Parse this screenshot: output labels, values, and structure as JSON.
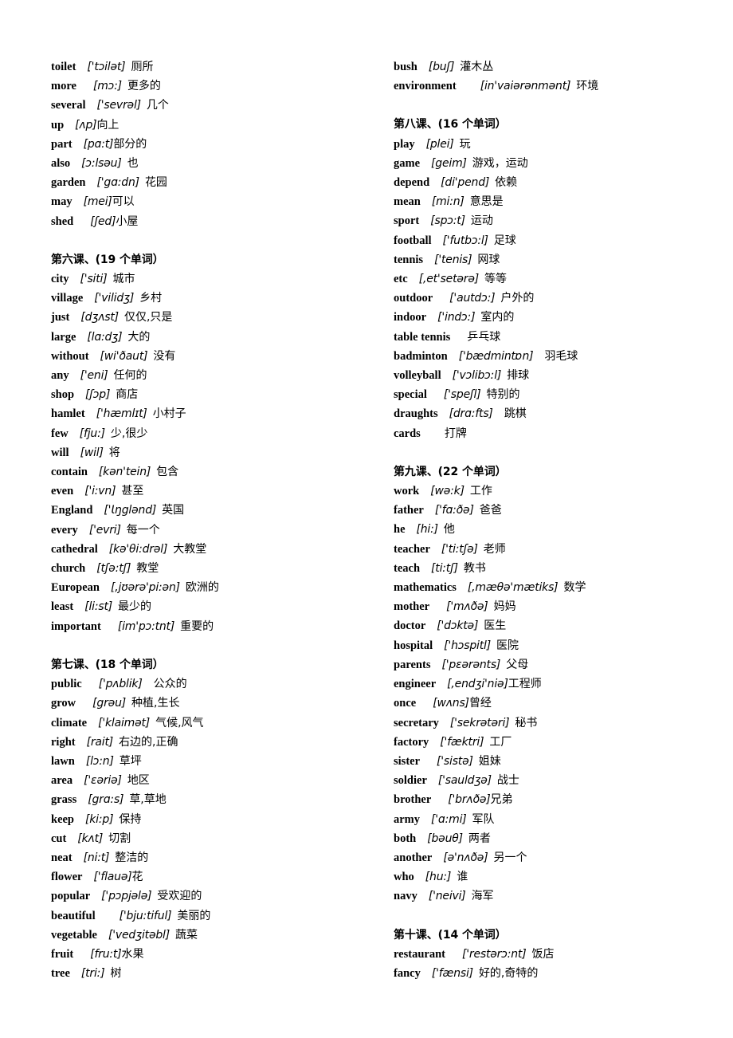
{
  "document": {
    "type": "vocabulary-list",
    "language_pair": "English-Chinese",
    "text_color": "#000000",
    "background_color": "#ffffff"
  },
  "columns": [
    {
      "name": "left-column",
      "sections": [
        {
          "heading": null,
          "entries": [
            {
              "word": "toilet",
              "phonetic": "['tɔilət]",
              "gloss": "厕所",
              "gap1": "sp2",
              "gap2": "sp1"
            },
            {
              "word": "more",
              "phonetic": "[mɔ:]",
              "gloss": "更多的",
              "gap1": "sp3",
              "gap2": "sp1"
            },
            {
              "word": "several",
              "phonetic": "['sevrəl]",
              "gloss": "几个",
              "gap1": "sp2",
              "gap2": "sp1"
            },
            {
              "word": "up",
              "phonetic": "[ʌp]",
              "gloss": "向上",
              "gap1": "sp2",
              "gap2": "sp0"
            },
            {
              "word": "part",
              "phonetic": "[pɑ:t]",
              "gloss": "部分的",
              "gap1": "sp2",
              "gap2": "sp0"
            },
            {
              "word": "also",
              "phonetic": "[ɔ:lsəu]",
              "gloss": "也",
              "gap1": "sp2",
              "gap2": "sp1"
            },
            {
              "word": "garden",
              "phonetic": "['gɑ:dn]",
              "gloss": "花园",
              "gap1": "sp2",
              "gap2": "sp1"
            },
            {
              "word": "may",
              "phonetic": "[mei]",
              "gloss": "可以",
              "gap1": "sp2",
              "gap2": "sp0"
            },
            {
              "word": "shed",
              "phonetic": "[ʃed]",
              "gloss": "小屋",
              "gap1": "sp3",
              "gap2": "sp0"
            }
          ]
        },
        {
          "heading": "第六课、(19 个单词）",
          "entries": [
            {
              "word": "city",
              "phonetic": "['siti]",
              "gloss": "城市",
              "gap1": "sp2",
              "gap2": "sp1"
            },
            {
              "word": "village",
              "phonetic": "['vilidʒ]",
              "gloss": "乡村",
              "gap1": "sp2",
              "gap2": "sp1"
            },
            {
              "word": "just",
              "phonetic": "[dʒʌst]",
              "gloss": "仅仅,只是",
              "gap1": "sp2",
              "gap2": "sp1"
            },
            {
              "word": "large",
              "phonetic": "[lɑ:dʒ]",
              "gloss": "大的",
              "gap1": "sp2",
              "gap2": "sp1"
            },
            {
              "word": "without",
              "phonetic": "[wi'ðaut]",
              "gloss": "没有",
              "gap1": "sp2",
              "gap2": "sp1"
            },
            {
              "word": "any",
              "phonetic": "['eni]",
              "gloss": "任何的",
              "gap1": "sp2",
              "gap2": "sp1"
            },
            {
              "word": "shop",
              "phonetic": "[ʃɔp]",
              "gloss": "商店",
              "gap1": "sp2",
              "gap2": "sp1"
            },
            {
              "word": "hamlet",
              "phonetic": "['hæmlɪt]",
              "gloss": "小村子",
              "gap1": "sp2",
              "gap2": "sp1"
            },
            {
              "word": "few",
              "phonetic": "[fju:]",
              "gloss": "少,很少",
              "gap1": "sp2",
              "gap2": "sp1"
            },
            {
              "word": "will",
              "phonetic": "[wil]",
              "gloss": "将",
              "gap1": "sp2",
              "gap2": "sp1"
            },
            {
              "word": "contain",
              "phonetic": "[kən'tein]",
              "gloss": "包含",
              "gap1": "sp2",
              "gap2": "sp1"
            },
            {
              "word": "even",
              "phonetic": "['i:vn]",
              "gloss": "甚至",
              "gap1": "sp2",
              "gap2": "sp1"
            },
            {
              "word": "England",
              "phonetic": "['Ɩŋglənd]",
              "gloss": "英国",
              "gap1": "sp2",
              "gap2": "sp1"
            },
            {
              "word": "every",
              "phonetic": "['evri]",
              "gloss": "每一个",
              "gap1": "sp2",
              "gap2": "sp1"
            },
            {
              "word": "cathedral",
              "phonetic": "[kə'θi:drəl]",
              "gloss": "大教堂",
              "gap1": "sp2",
              "gap2": "sp1"
            },
            {
              "word": "church",
              "phonetic": "[tʃə:tʃ]",
              "gloss": "教堂",
              "gap1": "sp2",
              "gap2": "sp1"
            },
            {
              "word": "European",
              "phonetic": "[,jʊərə'pi:ən]",
              "gloss": "欧洲的",
              "gap1": "sp2",
              "gap2": "sp1"
            },
            {
              "word": "least",
              "phonetic": "[li:st]",
              "gloss": "最少的",
              "gap1": "sp2",
              "gap2": "sp1"
            },
            {
              "word": "important",
              "phonetic": "[im'pɔ:tnt]",
              "gloss": "重要的",
              "gap1": "sp3",
              "gap2": "sp1"
            }
          ]
        },
        {
          "heading": "第七课、(18 个单词）",
          "entries": [
            {
              "word": "public",
              "phonetic": "['pʌblik]",
              "gloss": "公众的",
              "gap1": "sp3",
              "gap2": "sp2"
            },
            {
              "word": "grow",
              "phonetic": "[grəu]",
              "gloss": "种植,生长",
              "gap1": "sp3",
              "gap2": "sp1"
            },
            {
              "word": "climate",
              "phonetic": "['klaimət]",
              "gloss": "气候,风气",
              "gap1": "sp2",
              "gap2": "sp1"
            },
            {
              "word": "right",
              "phonetic": "[rait]",
              "gloss": "右边的,正确",
              "gap1": "sp2",
              "gap2": "sp1"
            },
            {
              "word": "lawn",
              "phonetic": "[lɔ:n]",
              "gloss": "草坪",
              "gap1": "sp2",
              "gap2": "sp1"
            },
            {
              "word": "area",
              "phonetic": "['ɛəriə]",
              "gloss": "地区",
              "gap1": "sp2",
              "gap2": "sp1"
            },
            {
              "word": "grass",
              "phonetic": "[grɑ:s]",
              "gloss": "草,草地",
              "gap1": "sp2",
              "gap2": "sp1"
            },
            {
              "word": "keep",
              "phonetic": "[ki:p]",
              "gloss": "保持",
              "gap1": "sp2",
              "gap2": "sp1"
            },
            {
              "word": "cut",
              "phonetic": "[kʌt]",
              "gloss": "切割",
              "gap1": "sp2",
              "gap2": "sp1"
            },
            {
              "word": "neat",
              "phonetic": "[ni:t]",
              "gloss": "整洁的",
              "gap1": "sp2",
              "gap2": "sp1"
            },
            {
              "word": "flower",
              "phonetic": "['flauə]",
              "gloss": "花",
              "gap1": "sp2",
              "gap2": "sp0"
            },
            {
              "word": "popular",
              "phonetic": "['pɔpjələ]",
              "gloss": "受欢迎的",
              "gap1": "sp2",
              "gap2": "sp1"
            },
            {
              "word": "beautiful",
              "phonetic": "['bju:tiful]",
              "gloss": "美丽的",
              "gap1": "sp4",
              "gap2": "sp1"
            },
            {
              "word": "vegetable",
              "phonetic": "['vedʒitəbl]",
              "gloss": "蔬菜",
              "gap1": "sp2",
              "gap2": "sp1"
            },
            {
              "word": "fruit",
              "phonetic": "[fru:t]",
              "gloss": "水果",
              "gap1": "sp3",
              "gap2": "sp0"
            },
            {
              "word": "tree",
              "phonetic": "[tri:]",
              "gloss": "树",
              "gap1": "sp2",
              "gap2": "sp1"
            }
          ]
        }
      ]
    },
    {
      "name": "right-column",
      "sections": [
        {
          "heading": null,
          "entries": [
            {
              "word": "bush",
              "phonetic": "[buʃ]",
              "gloss": "灌木丛",
              "gap1": "sp2",
              "gap2": "sp1"
            },
            {
              "word": "environment",
              "phonetic": "[in'vaiərənmənt]",
              "gloss": "环境",
              "gap1": "sp4",
              "gap2": "sp1"
            }
          ]
        },
        {
          "heading": "第八课、(16 个单词）",
          "entries": [
            {
              "word": "play",
              "phonetic": "[plei]",
              "gloss": "玩",
              "gap1": "sp2",
              "gap2": "sp1"
            },
            {
              "word": "game",
              "phonetic": "[geim]",
              "gloss": "游戏，运动",
              "gap1": "sp2",
              "gap2": "sp1"
            },
            {
              "word": "depend",
              "phonetic": "[di'pend]",
              "gloss": "依赖",
              "gap1": "sp2",
              "gap2": "sp1"
            },
            {
              "word": "mean",
              "phonetic": "[mi:n]",
              "gloss": "意思是",
              "gap1": "sp2",
              "gap2": "sp1"
            },
            {
              "word": "sport",
              "phonetic": "[spɔ:t]",
              "gloss": "运动",
              "gap1": "sp2",
              "gap2": "sp1"
            },
            {
              "word": "football",
              "phonetic": "['futbɔ:l]",
              "gloss": "足球",
              "gap1": "sp2",
              "gap2": "sp1"
            },
            {
              "word": "tennis",
              "phonetic": "['tenis]",
              "gloss": "网球",
              "gap1": "sp2",
              "gap2": "sp1"
            },
            {
              "word": "etc",
              "phonetic": "[,et'setərə]",
              "gloss": "等等",
              "gap1": "sp2",
              "gap2": "sp1"
            },
            {
              "word": "outdoor",
              "phonetic": "['autdɔ:]",
              "gloss": "户外的",
              "gap1": "sp3",
              "gap2": "sp1"
            },
            {
              "word": "indoor",
              "phonetic": "['indɔ:]",
              "gloss": "室内的",
              "gap1": "sp2",
              "gap2": "sp1"
            },
            {
              "word": "table   tennis",
              "phonetic": "",
              "gloss": "乒乓球",
              "gap1": "sp0",
              "gap2": "sp3"
            },
            {
              "word": "badminton",
              "phonetic": "['bædmintɒn]",
              "gloss": "羽毛球",
              "gap1": "sp2",
              "gap2": "sp2"
            },
            {
              "word": "volleyball",
              "phonetic": "['vɔlibɔ:l]",
              "gloss": "排球",
              "gap1": "sp2",
              "gap2": "sp1"
            },
            {
              "word": "special",
              "phonetic": "['speʃl]",
              "gloss": "特别的",
              "gap1": "sp3",
              "gap2": "sp1"
            },
            {
              "word": "draughts",
              "phonetic": "[drɑ:fts]",
              "gloss": "跳棋",
              "gap1": "sp2",
              "gap2": "sp2"
            },
            {
              "word": "cards",
              "phonetic": "",
              "gloss": "打牌",
              "gap1": "sp0",
              "gap2": "sp4"
            }
          ]
        },
        {
          "heading": "第九课、(22 个单词）",
          "entries": [
            {
              "word": "work",
              "phonetic": "[wə:k]",
              "gloss": "工作",
              "gap1": "sp2",
              "gap2": "sp1"
            },
            {
              "word": "father",
              "phonetic": "['fɑ:ðə]",
              "gloss": "爸爸",
              "gap1": "sp2",
              "gap2": "sp1"
            },
            {
              "word": "he",
              "phonetic": "[hi:]",
              "gloss": "他",
              "gap1": "sp2",
              "gap2": "sp1"
            },
            {
              "word": "teacher",
              "phonetic": "['ti:tʃə]",
              "gloss": "老师",
              "gap1": "sp2",
              "gap2": "sp1"
            },
            {
              "word": "teach",
              "phonetic": "[ti:tʃ]",
              "gloss": "教书",
              "gap1": "sp2",
              "gap2": "sp1"
            },
            {
              "word": "mathematics",
              "phonetic": "[,mæθə'mætiks]",
              "gloss": "数学",
              "gap1": "sp2",
              "gap2": "sp1"
            },
            {
              "word": "mother",
              "phonetic": "['mʌðə]",
              "gloss": "妈妈",
              "gap1": "sp3",
              "gap2": "sp1"
            },
            {
              "word": "doctor",
              "phonetic": "['dɔktə]",
              "gloss": "医生",
              "gap1": "sp2",
              "gap2": "sp1"
            },
            {
              "word": "hospital",
              "phonetic": "['hɔspitl]",
              "gloss": "医院",
              "gap1": "sp2",
              "gap2": "sp1"
            },
            {
              "word": "parents",
              "phonetic": "['pɛərənts]",
              "gloss": "父母",
              "gap1": "sp2",
              "gap2": "sp1"
            },
            {
              "word": "engineer",
              "phonetic": "[,endʒi'niə]",
              "gloss": "工程师",
              "gap1": "sp2",
              "gap2": "sp0"
            },
            {
              "word": "once",
              "phonetic": "[wʌns]",
              "gloss": "曾经",
              "gap1": "sp3",
              "gap2": "sp0"
            },
            {
              "word": "secretary",
              "phonetic": "['sekrətəri]",
              "gloss": "秘书",
              "gap1": "sp2",
              "gap2": "sp1"
            },
            {
              "word": "factory",
              "phonetic": "['fæktri]",
              "gloss": "工厂",
              "gap1": "sp2",
              "gap2": "sp1"
            },
            {
              "word": "sister",
              "phonetic": "['sistə]",
              "gloss": "姐妹",
              "gap1": "sp3",
              "gap2": "sp1"
            },
            {
              "word": "soldier",
              "phonetic": "['sauldʒə]",
              "gloss": "战士",
              "gap1": "sp2",
              "gap2": "sp1"
            },
            {
              "word": "brother",
              "phonetic": "['brʌðə]",
              "gloss": "兄弟",
              "gap1": "sp3",
              "gap2": "sp0"
            },
            {
              "word": "army",
              "phonetic": "['ɑ:mi]",
              "gloss": "军队",
              "gap1": "sp2",
              "gap2": "sp1"
            },
            {
              "word": "both",
              "phonetic": "[bəuθ]",
              "gloss": "两者",
              "gap1": "sp2",
              "gap2": "sp1"
            },
            {
              "word": "another",
              "phonetic": "[ə'nʌðə]",
              "gloss": "另一个",
              "gap1": "sp2",
              "gap2": "sp1"
            },
            {
              "word": "who",
              "phonetic": "[hu:]",
              "gloss": "谁",
              "gap1": "sp2",
              "gap2": "sp1"
            },
            {
              "word": "navy",
              "phonetic": "['neivi]",
              "gloss": "海军",
              "gap1": "sp2",
              "gap2": "sp1"
            }
          ]
        },
        {
          "heading": "第十课、(14 个单词）",
          "entries": [
            {
              "word": "restaurant",
              "phonetic": "['restərɔ:nt]",
              "gloss": "饭店",
              "gap1": "sp3",
              "gap2": "sp1"
            },
            {
              "word": "fancy",
              "phonetic": "['fænsi]",
              "gloss": "好的,奇特的",
              "gap1": "sp2",
              "gap2": "sp1"
            }
          ]
        }
      ]
    }
  ]
}
